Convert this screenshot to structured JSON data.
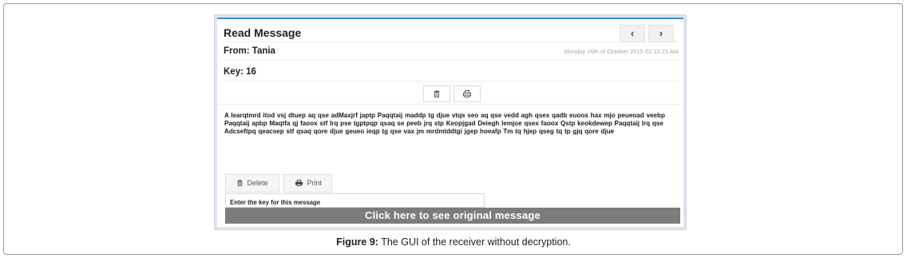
{
  "panel": {
    "title": "Read Message",
    "nav_prev": "‹",
    "nav_next": "›",
    "from": "From: Tania",
    "date": "Monday 26th of October 2015 02:10:23 AM",
    "key": "Key: 16"
  },
  "toolbar": {
    "trash_icon": "trash-icon",
    "print_icon": "printer-icon"
  },
  "message": {
    "body": "A learqtmrd itod vsj dtuep aq qse adMaxjrf japtp Paqqtaij maddp tg djue vtqs seo aq qse vedd agh qsex qadb euoox hax mjo peueoad veebp Paqqtaij apbp Maqtfa qj faoox stf lrq pse tgptpqp qsaq se peeb jrq stp Keopjgad Deiegh lemjoe qsex faoox Qstp keokdewep Paqqtaij lrq qse Adcseftpq qeacsep stf qsaq qore djue geueo ieqp tg qse vax jm mrdmtddtgi jgep hoeafp Tm tq hjep qseg tq tp gjq qore djue"
  },
  "actions": {
    "delete_label": "Delete",
    "print_label": "Print",
    "key_input_value": "Enter the key for this message",
    "original_button": "Click here to see original message"
  },
  "caption": {
    "label": "Figure 9:",
    "text": " The GUI of the receiver without decryption."
  },
  "colors": {
    "accent_top_border": "#3d8fcf",
    "original_bar_bg": "#7c7c7c"
  }
}
